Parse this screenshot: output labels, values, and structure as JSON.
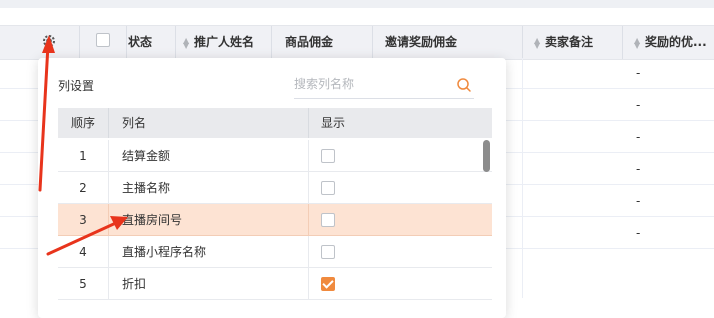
{
  "table": {
    "headers": {
      "status": "状态",
      "promoter_name": "推广人姓名",
      "product_commission": "商品佣金",
      "invite_commission": "邀请奖励佣金",
      "seller_note": "卖家备注",
      "reward_coupon": "奖励的优..."
    },
    "dashes": [
      "-",
      "-",
      "-",
      "-",
      "-",
      "-"
    ]
  },
  "column_settings": {
    "title": "列设置",
    "search_placeholder": "搜索列名称",
    "headers": {
      "index": "顺序",
      "name": "列名",
      "display": "显示"
    },
    "rows": [
      {
        "index": "1",
        "name": "结算金额",
        "checked": false
      },
      {
        "index": "2",
        "name": "主播名称",
        "checked": false
      },
      {
        "index": "3",
        "name": "直播房间号",
        "checked": false,
        "highlighted": true
      },
      {
        "index": "4",
        "name": "直播小程序名称",
        "checked": false
      },
      {
        "index": "5",
        "name": "折扣",
        "checked": true
      }
    ]
  },
  "colors": {
    "accent": "#f08a3e",
    "highlight_row": "#fde3d3",
    "arrow": "#e8341c"
  }
}
